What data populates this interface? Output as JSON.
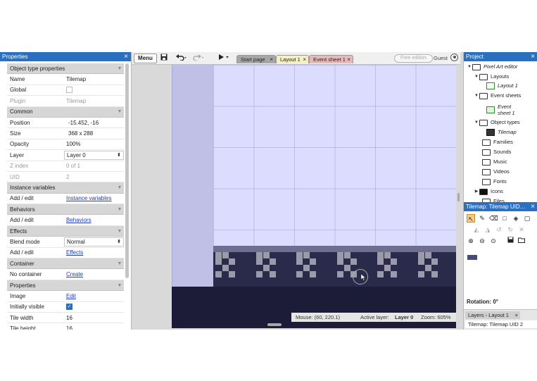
{
  "properties": {
    "title": "Properties",
    "close": "×",
    "rows": [
      {
        "type": "section",
        "name": "Object type properties"
      },
      {
        "type": "text",
        "name": "Name",
        "value": "Tilemap"
      },
      {
        "type": "check",
        "name": "Global",
        "checked": false
      },
      {
        "type": "text",
        "name": "Plugin",
        "value": "Tilemap",
        "disabled": true
      },
      {
        "type": "section",
        "name": "Common"
      },
      {
        "type": "expand",
        "name": "Position",
        "value": "-15.452, -16"
      },
      {
        "type": "expand",
        "name": "Size",
        "value": "368 x 288"
      },
      {
        "type": "text",
        "name": "Opacity",
        "value": "100%"
      },
      {
        "type": "select",
        "name": "Layer",
        "value": "Layer 0"
      },
      {
        "type": "text",
        "name": "Z index",
        "value": "0 of 1",
        "disabled": true
      },
      {
        "type": "text",
        "name": "UID",
        "value": "2",
        "disabled": true
      },
      {
        "type": "section",
        "name": "Instance variables"
      },
      {
        "type": "link",
        "name": "Add / edit",
        "value": "Instance variables"
      },
      {
        "type": "section",
        "name": "Behaviors"
      },
      {
        "type": "link",
        "name": "Add / edit",
        "value": "Behaviors"
      },
      {
        "type": "section",
        "name": "Effects"
      },
      {
        "type": "select",
        "name": "Blend mode",
        "value": "Normal"
      },
      {
        "type": "link",
        "name": "Add / edit",
        "value": "Effects"
      },
      {
        "type": "section",
        "name": "Container"
      },
      {
        "type": "link",
        "name": "No container",
        "value": "Create"
      },
      {
        "type": "section",
        "name": "Properties"
      },
      {
        "type": "link",
        "name": "Image",
        "value": "Edit"
      },
      {
        "type": "check",
        "name": "Initially visible",
        "checked": true
      },
      {
        "type": "text",
        "name": "Tile width",
        "value": "16"
      },
      {
        "type": "text",
        "name": "Tile height",
        "value": "16"
      }
    ]
  },
  "toolbar": {
    "menu_label": "Menu",
    "save_icon": "save-icon",
    "undo_icon": "undo-icon",
    "redo_icon": "redo-icon",
    "play_icon": "play-icon",
    "free_edition": "Free edition",
    "user": "Guest",
    "tabs": [
      {
        "label": "Start page",
        "color": "#a6a6a6"
      },
      {
        "label": "Layout 1",
        "color": "#f5f0c2"
      },
      {
        "label": "Event sheet 1",
        "color": "#e9b9b9"
      }
    ],
    "tab_close": "×"
  },
  "status": {
    "mouse_label": "Mouse: (60, 220.1)",
    "active_layer_label": "Active layer:",
    "active_layer": "Layer 0",
    "zoom_label": "Zoom: 605%"
  },
  "project": {
    "title": "Project",
    "close": "×",
    "tree": [
      {
        "label": "Pixel Art editor",
        "italic": true,
        "twisty": "▼",
        "icon": "folder"
      },
      {
        "label": "Layouts",
        "twisty": "▼",
        "icon": "folder"
      },
      {
        "label": "Layout 1",
        "italic": true,
        "icon": "layout"
      },
      {
        "label": "Event sheets",
        "twisty": "▼",
        "icon": "folder"
      },
      {
        "label": "Event",
        "label2": "sheet 1",
        "italic": true,
        "icon": "event"
      },
      {
        "label": "Object types",
        "twisty": "▼",
        "icon": "folder"
      },
      {
        "label": "Tilemap",
        "italic": true,
        "icon": "tilemap"
      },
      {
        "label": "Families",
        "icon": "folder"
      },
      {
        "label": "Sounds",
        "icon": "folder"
      },
      {
        "label": "Music",
        "icon": "folder"
      },
      {
        "label": "Videos",
        "icon": "folder"
      },
      {
        "label": "Fonts",
        "icon": "folder"
      },
      {
        "label": "Icons",
        "twisty": "▶",
        "icon": "folder-filled"
      },
      {
        "label": "Files",
        "icon": "folder"
      }
    ]
  },
  "tilemap": {
    "title": "Tilemap: Tilemap UID…",
    "close": "×",
    "rotation": "Rotation: 0°",
    "tabs": [
      {
        "label": "Layers - Layout 1"
      },
      {
        "label": "Tilemap: Tilemap UID 2"
      }
    ],
    "tab_close": "×"
  }
}
